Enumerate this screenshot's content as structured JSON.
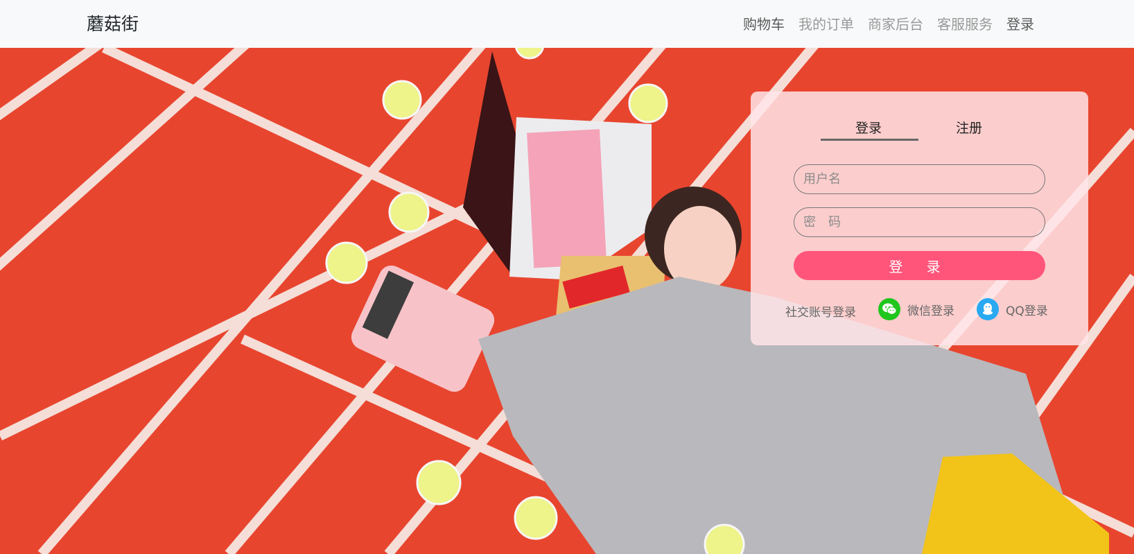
{
  "header": {
    "brand": "蘑菇街",
    "nav": [
      {
        "label": "购物车"
      },
      {
        "label": "我的订单"
      },
      {
        "label": "商家后台"
      },
      {
        "label": "客服服务"
      },
      {
        "label": "登录"
      }
    ]
  },
  "login_card": {
    "tabs": {
      "login": "登录",
      "register": "注册"
    },
    "username_placeholder": "用户名",
    "password_placeholder": "密　码",
    "submit_label": "登 录",
    "social_label": "社交账号登录",
    "wechat_label": "微信登录",
    "qq_label": "QQ登录"
  },
  "colors": {
    "accent": "#ff557a",
    "wechat": "#1ec61e",
    "qq": "#28a9f1",
    "hero_background": "#e8422c"
  },
  "icons": [
    "wechat-icon",
    "qq-icon"
  ]
}
